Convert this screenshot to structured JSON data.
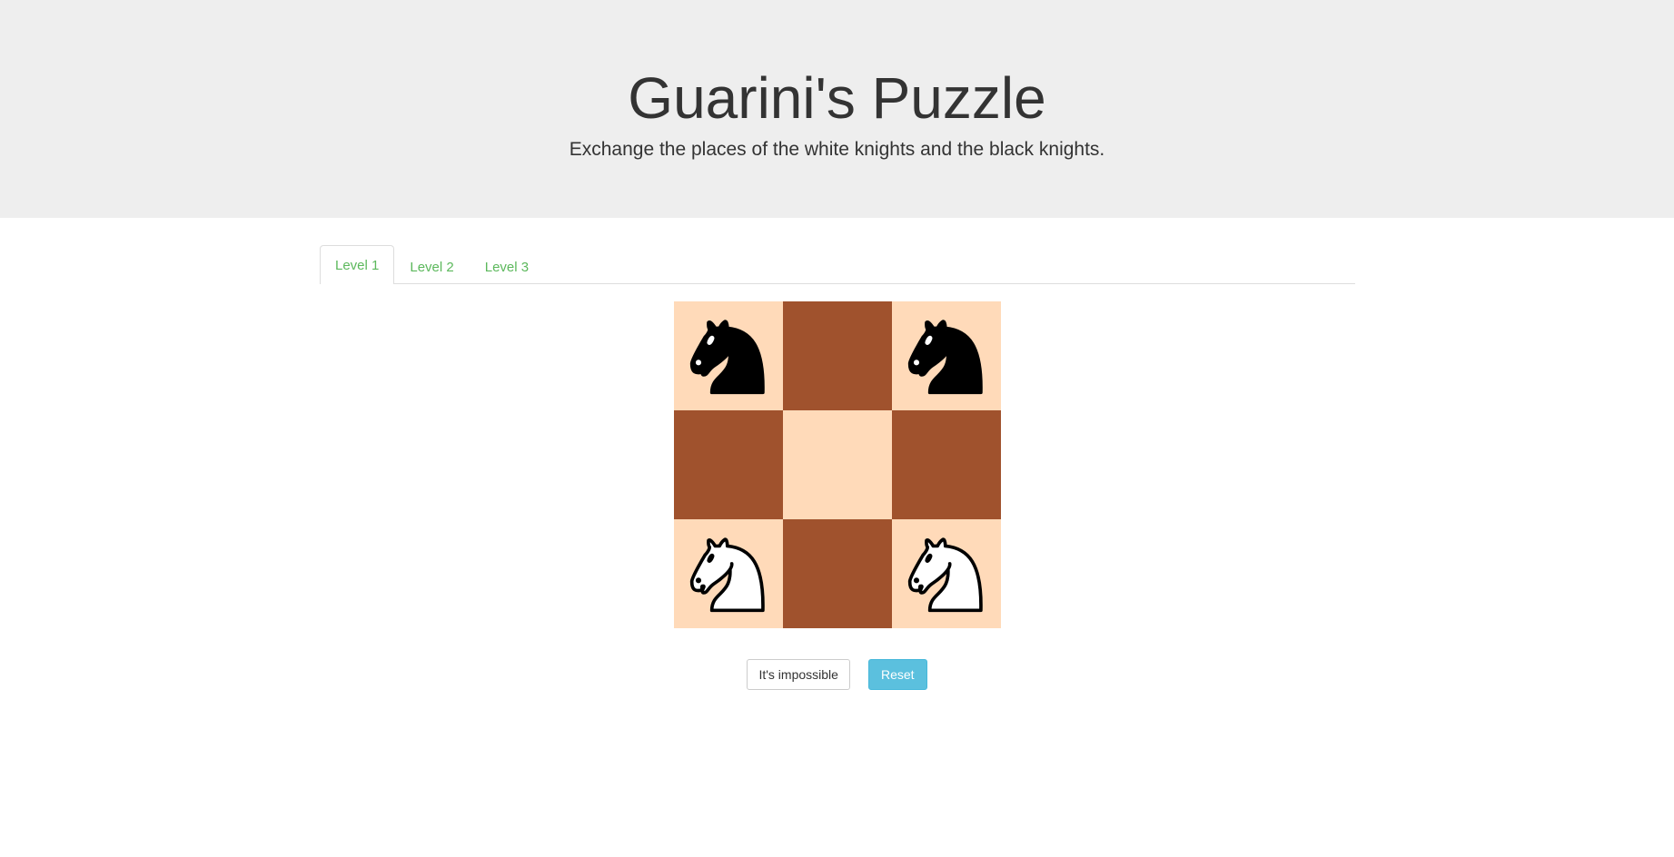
{
  "header": {
    "title": "Guarini's Puzzle",
    "subtitle": "Exchange the places of the white knights and the black knights."
  },
  "tabs": [
    {
      "label": "Level 1",
      "active": true
    },
    {
      "label": "Level 2",
      "active": false
    },
    {
      "label": "Level 3",
      "active": false
    }
  ],
  "board": {
    "size": 3,
    "light_color": "#ffdab9",
    "dark_color": "#a0522d",
    "squares": [
      [
        "black-knight",
        "empty",
        "black-knight"
      ],
      [
        "empty",
        "empty",
        "empty"
      ],
      [
        "white-knight",
        "empty",
        "white-knight"
      ]
    ]
  },
  "buttons": {
    "impossible_label": "It's impossible",
    "reset_label": "Reset"
  },
  "colors": {
    "header_bg": "#eeeeee",
    "tab_text": "#5cb85c",
    "reset_button": "#5bc0de"
  }
}
